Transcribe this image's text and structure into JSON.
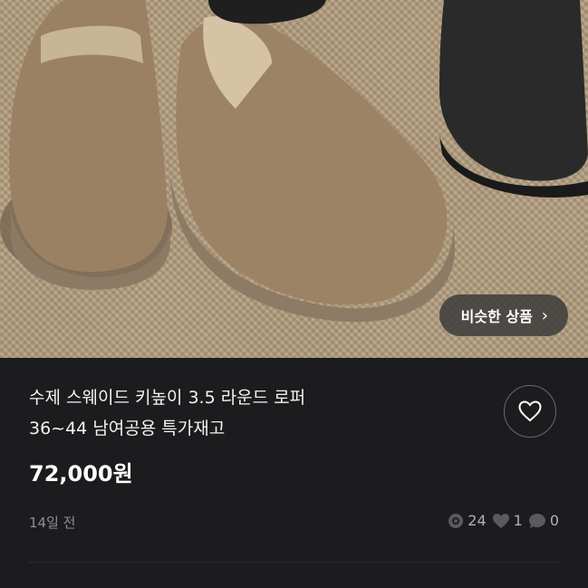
{
  "product": {
    "title_line1": "수제 스웨이드 키높이 3.5 라운드 로퍼",
    "title_line2": "36~44  남여공용 특가재고",
    "price": "72,000원",
    "posted_ago": "14일 전",
    "image_alt": "suede round loafers photo"
  },
  "similar_button": {
    "label": "비슷한 상품",
    "chevron": "›"
  },
  "stats": {
    "views": "24",
    "likes": "1",
    "chats": "0"
  },
  "icons": {
    "like": "heart-outline-icon",
    "views": "eye-icon",
    "likes": "heart-icon",
    "chats": "chat-bubble-icon",
    "chevron": "chevron-right-icon"
  },
  "colors": {
    "background": "#1c1c1e",
    "text": "#ffffff",
    "muted": "#8e8e93"
  }
}
